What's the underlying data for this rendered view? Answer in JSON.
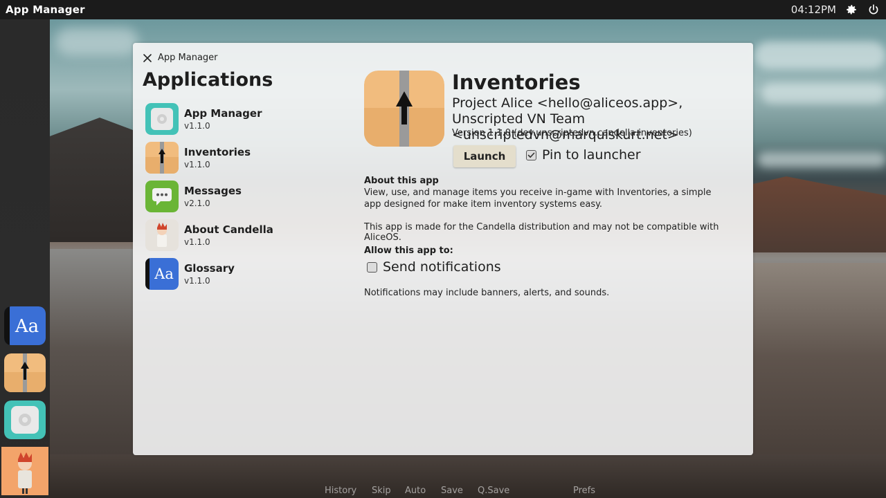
{
  "topbar": {
    "title": "App Manager",
    "clock": "04:12PM",
    "icons": [
      "gear-icon",
      "power-icon"
    ]
  },
  "dock": {
    "items": [
      {
        "app": "Glossary",
        "icon": "glossary-icon"
      },
      {
        "app": "Inventories",
        "icon": "inventories-icon"
      },
      {
        "app": "App Manager",
        "icon": "app-manager-icon"
      },
      {
        "app": "About Candella",
        "icon": "about-candella-icon"
      }
    ]
  },
  "window": {
    "title": "App Manager",
    "applications_heading": "Applications",
    "apps": [
      {
        "name": "App Manager",
        "version": "v1.1.0",
        "icon": "app-manager-icon"
      },
      {
        "name": "Inventories",
        "version": "v1.1.0",
        "icon": "inventories-icon"
      },
      {
        "name": "Messages",
        "version": "v2.1.0",
        "icon": "messages-icon"
      },
      {
        "name": "About Candella",
        "version": "v1.1.0",
        "icon": "about-candella-icon"
      },
      {
        "name": "Glossary",
        "version": "v1.1.0",
        "icon": "glossary-icon"
      }
    ],
    "detail": {
      "name": "Inventories",
      "authors": "Project Alice <hello@aliceos.app>, Unscripted VN Team <unscriptedvn@marquiskurt.net>",
      "version": "Version 1.1.0 (dev.unscriptedvn.candella.inventories)",
      "launch_label": "Launch",
      "pin_label": "Pin to launcher",
      "pin_checked": true,
      "about_heading": "About this app",
      "about_text": "View, use, and manage items you receive in-game with Inventories, a simple app designed for make item inventory systems easy.",
      "compat_text": "This app is made for the Candella distribution and may not be compatible with AliceOS.",
      "allow_heading": "Allow this app to:",
      "notifications_label": "Send notifications",
      "notifications_checked": false,
      "notifications_note": "Notifications may include banners, alerts, and sounds."
    }
  },
  "quick_menu": [
    "History",
    "Skip",
    "Auto",
    "Save",
    "Q.Save",
    "Prefs"
  ],
  "colors": {
    "topbar": "#1b1b1b",
    "dock": "#2a2a2a",
    "window_bg": "#f6f6f6",
    "launch_button": "#e4decc",
    "inventories_icon": "#f1bc7e",
    "app_manager_icon": "#43c2b7",
    "messages_icon": "#6ab536",
    "glossary_icon": "#3a6fd6"
  }
}
